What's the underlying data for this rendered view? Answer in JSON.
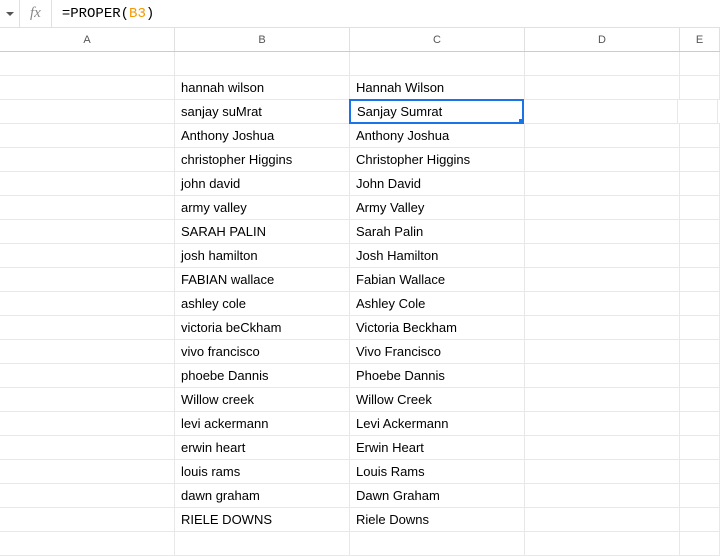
{
  "formula": {
    "prefix": "=PROPER(",
    "ref": "B3",
    "suffix": ")"
  },
  "columns": [
    "A",
    "B",
    "C",
    "D",
    "E"
  ],
  "selectedCell": {
    "row": 2,
    "col": "C"
  },
  "rows": [
    {
      "A": "",
      "B": "",
      "C": "",
      "D": ""
    },
    {
      "A": "",
      "B": "hannah wilson",
      "C": "Hannah Wilson",
      "D": ""
    },
    {
      "A": "",
      "B": "sanjay suMrat",
      "C": "Sanjay Sumrat",
      "D": ""
    },
    {
      "A": "",
      "B": "Anthony Joshua",
      "C": "Anthony Joshua",
      "D": ""
    },
    {
      "A": "",
      "B": "christopher Higgins",
      "C": "Christopher Higgins",
      "D": ""
    },
    {
      "A": "",
      "B": "john david",
      "C": "John David",
      "D": ""
    },
    {
      "A": "",
      "B": "army valley",
      "C": "Army Valley",
      "D": ""
    },
    {
      "A": "",
      "B": "SARAH PALIN",
      "C": "Sarah Palin",
      "D": ""
    },
    {
      "A": "",
      "B": "josh hamilton",
      "C": "Josh Hamilton",
      "D": ""
    },
    {
      "A": "",
      "B": "FABIAN wallace",
      "C": "Fabian Wallace",
      "D": ""
    },
    {
      "A": "",
      "B": "ashley cole",
      "C": "Ashley Cole",
      "D": ""
    },
    {
      "A": "",
      "B": "victoria beCkham",
      "C": "Victoria Beckham",
      "D": ""
    },
    {
      "A": "",
      "B": "vivo francisco",
      "C": "Vivo Francisco",
      "D": ""
    },
    {
      "A": "",
      "B": "phoebe Dannis",
      "C": "Phoebe Dannis",
      "D": ""
    },
    {
      "A": "",
      "B": "Willow creek",
      "C": "Willow Creek",
      "D": ""
    },
    {
      "A": "",
      "B": "levi ackermann",
      "C": "Levi Ackermann",
      "D": ""
    },
    {
      "A": "",
      "B": "erwin heart",
      "C": "Erwin Heart",
      "D": ""
    },
    {
      "A": "",
      "B": "louis rams",
      "C": "Louis Rams",
      "D": ""
    },
    {
      "A": "",
      "B": "dawn graham",
      "C": "Dawn Graham",
      "D": ""
    },
    {
      "A": "",
      "B": "RIELE DOWNS",
      "C": "Riele Downs",
      "D": ""
    },
    {
      "A": "",
      "B": "",
      "C": "",
      "D": ""
    }
  ]
}
